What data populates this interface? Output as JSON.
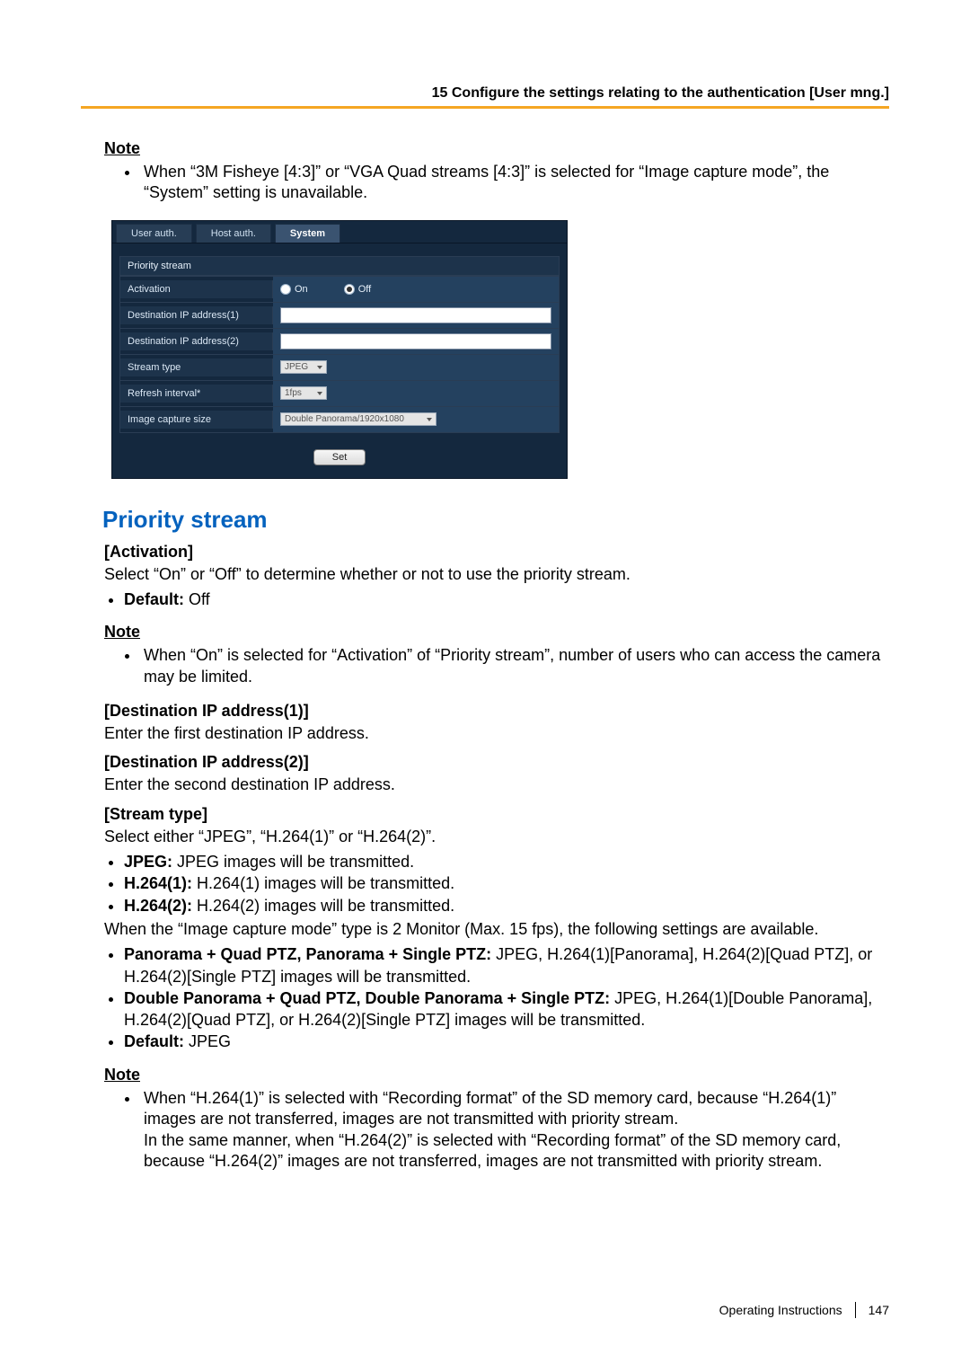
{
  "header": {
    "breadcrumb": "15 Configure the settings relating to the authentication [User mng.]"
  },
  "topnote": {
    "title": "Note",
    "item": "When “3M Fisheye [4:3]” or “VGA Quad streams [4:3]” is selected for “Image capture mode”, the “System” setting is unavailable."
  },
  "ui": {
    "tabs": {
      "user_auth": "User auth.",
      "host_auth": "Host auth.",
      "system": "System"
    },
    "section_title": "Priority stream",
    "rows": {
      "activation": {
        "label": "Activation",
        "on": "On",
        "off": "Off",
        "selected": "Off"
      },
      "dest1": {
        "label": "Destination IP address(1)"
      },
      "dest2": {
        "label": "Destination IP address(2)"
      },
      "stream_type": {
        "label": "Stream type",
        "value": "JPEG"
      },
      "refresh": {
        "label": "Refresh interval*",
        "value": "1fps"
      },
      "capture": {
        "label": "Image capture size",
        "value": "Double Panorama/1920x1080"
      }
    },
    "set": "Set"
  },
  "ps_heading": "Priority stream",
  "activation": {
    "title": "[Activation]",
    "desc": "Select “On” or “Off” to determine whether or not to use the priority stream.",
    "default_label": "Default:",
    "default_val": " Off"
  },
  "note2": {
    "title": "Note",
    "item": "When “On” is selected for “Activation” of “Priority stream”, number of users who can access the camera may be limited."
  },
  "dest1": {
    "title": "[Destination IP address(1)]",
    "desc": "Enter the first destination IP address."
  },
  "dest2": {
    "title": "[Destination IP address(2)]",
    "desc": "Enter the second destination IP address."
  },
  "streamtype": {
    "title": "[Stream type]",
    "desc": "Select either “JPEG”, “H.264(1)” or “H.264(2)”.",
    "jpeg_label": "JPEG:",
    "jpeg_rest": " JPEG images will be transmitted.",
    "h1_label": "H.264(1):",
    "h1_rest": " H.264(1) images will be transmitted.",
    "h2_label": "H.264(2):",
    "h2_rest": " H.264(2) images will be transmitted.",
    "mode_line": "When the “Image capture mode” type is 2 Monitor (Max. 15 fps), the following settings are available.",
    "pano_label": "Panorama + Quad PTZ, Panorama + Single PTZ:",
    "pano_rest": " JPEG, H.264(1)[Panorama], H.264(2)[Quad PTZ], or H.264(2)[Single PTZ] images will be transmitted.",
    "dpano_label": "Double Panorama + Quad PTZ, Double Panorama + Single PTZ:",
    "dpano_rest": " JPEG, H.264(1)[Double Panorama], H.264(2)[Quad PTZ], or H.264(2)[Single PTZ] images will be transmitted.",
    "default_label": "Default:",
    "default_val": " JPEG"
  },
  "note3": {
    "title": "Note",
    "line1": "When “H.264(1)” is selected with “Recording format” of the SD memory card, because “H.264(1)” images are not transferred, images are not transmitted with priority stream.",
    "line2": "In the same manner, when “H.264(2)” is selected with “Recording format” of the SD memory card, because “H.264(2)” images are not transferred, images are not transmitted with priority stream."
  },
  "footer": {
    "label": "Operating Instructions",
    "page": "147"
  }
}
